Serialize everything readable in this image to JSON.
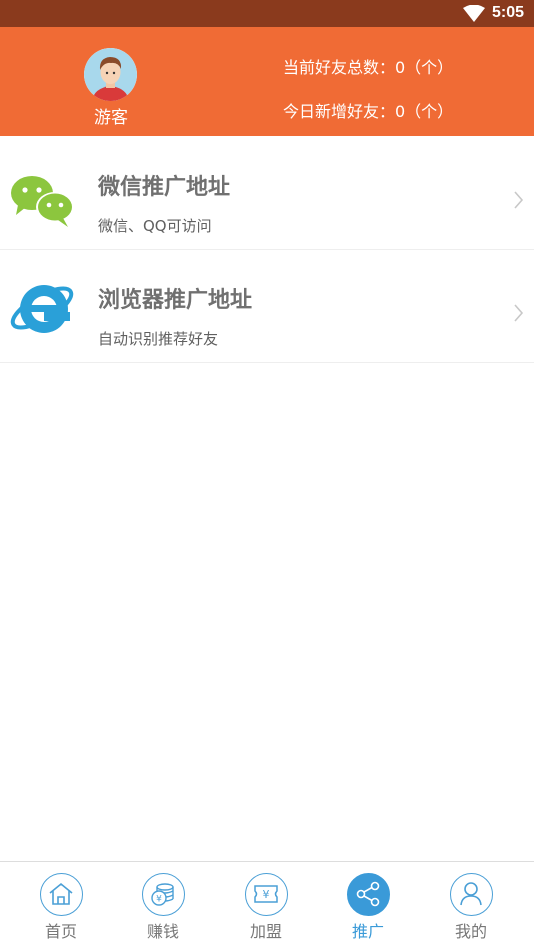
{
  "status_bar": {
    "time": "5:05"
  },
  "header": {
    "user_name": "游客",
    "total_friends": "当前好友总数：0（个）",
    "today_new": "今日新增好友：0（个）"
  },
  "list": [
    {
      "title": "微信推广地址",
      "subtitle": "微信、QQ可访问",
      "icon": "wechat-icon"
    },
    {
      "title": "浏览器推广地址",
      "subtitle": "自动识别推荐好友",
      "icon": "ie-browser-icon"
    }
  ],
  "tabs": [
    {
      "label": "首页",
      "icon": "home-icon"
    },
    {
      "label": "赚钱",
      "icon": "coins-icon"
    },
    {
      "label": "加盟",
      "icon": "ticket-icon"
    },
    {
      "label": "推广",
      "icon": "share-icon",
      "active": true
    },
    {
      "label": "我的",
      "icon": "user-icon"
    }
  ],
  "colors": {
    "status_bar": "#8a3a1d",
    "header": "#f06b35",
    "accent": "#3a9ad8"
  }
}
